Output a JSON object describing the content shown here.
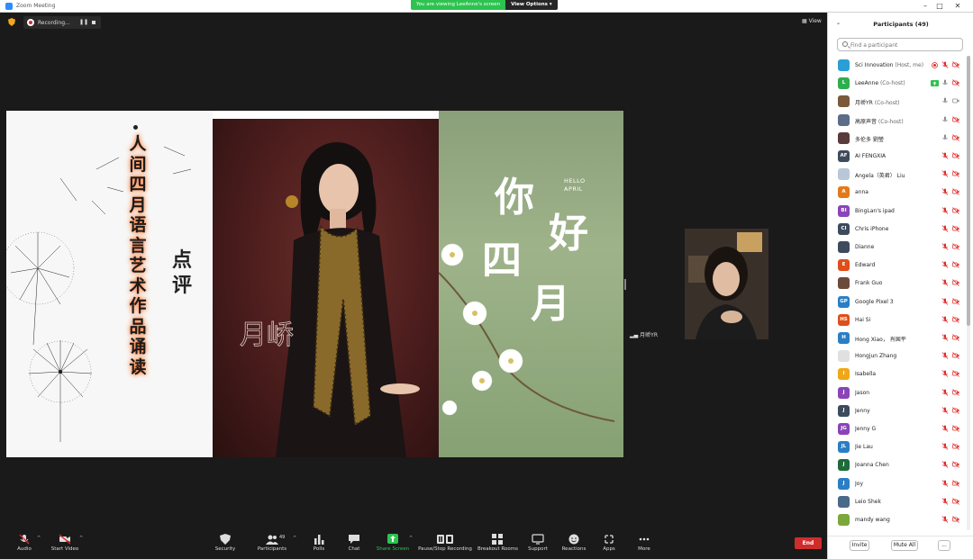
{
  "window": {
    "title": "Zoom Meeting"
  },
  "banner": {
    "viewing": "You are viewing LeeAnne's screen",
    "view_options": "View Options ▾"
  },
  "meeting": {
    "recording_label": "Recording...",
    "view_label": "View",
    "tile_name": "月峤YR"
  },
  "slide": {
    "vertical_title": [
      "人",
      "间",
      "四",
      "月",
      "语",
      "言",
      "艺",
      "术",
      "作",
      "品",
      "诵",
      "读"
    ],
    "review": [
      "点",
      "评"
    ],
    "signature": "月峤",
    "greeting": [
      "你",
      "好",
      "四",
      "月"
    ],
    "hello": [
      "HELLO",
      "APRIL"
    ]
  },
  "toolbar": {
    "audio": "Audio",
    "start_video": "Start Video",
    "security": "Security",
    "participants": "Participants",
    "participants_count": "49",
    "polls": "Polls",
    "chat": "Chat",
    "share_screen": "Share Screen",
    "pause_recording": "Pause/Stop Recording",
    "breakout_rooms": "Breakout Rooms",
    "support": "Support",
    "reactions": "Reactions",
    "apps": "Apps",
    "more": "More",
    "end": "End"
  },
  "panel": {
    "title": "Participants (49)",
    "search_placeholder": "Find a participant",
    "invite": "Invite",
    "mute_all": "Mute All",
    "more": "...",
    "participants": [
      {
        "name": "Sci Innovation",
        "role": " (Host, me)",
        "initials": "",
        "color": "#2a9fd6",
        "mic": "rec",
        "cam": "off"
      },
      {
        "name": "LeeAnne",
        "role": " (Co-host)",
        "initials": "L",
        "color": "#2eae4f",
        "mic": "on",
        "cam": "off",
        "sharing": true
      },
      {
        "name": "月峤YR",
        "role": " (Co-host)",
        "initials": "",
        "color": "#7a5a3a",
        "mic": "on",
        "cam": "on"
      },
      {
        "name": "高原声音",
        "role": " (Co-host)",
        "initials": "",
        "color": "#5b6d88",
        "mic": "on",
        "cam": "off"
      },
      {
        "name": "多伦多 劉瑩",
        "role": "",
        "initials": "",
        "color": "#5a3b3b",
        "mic": "on",
        "cam": "off"
      },
      {
        "name": "AI FENGXIA",
        "role": "",
        "initials": "AF",
        "color": "#3d4b5c",
        "mic": "off",
        "cam": "off"
      },
      {
        "name": "Angela（英君） Liu",
        "role": "",
        "initials": "",
        "color": "#b9c7d8",
        "mic": "off",
        "cam": "off"
      },
      {
        "name": "anna",
        "role": "",
        "initials": "A",
        "color": "#e27a1a",
        "mic": "off",
        "cam": "off"
      },
      {
        "name": "BingLan's ipad",
        "role": "",
        "initials": "BI",
        "color": "#8a44b8",
        "mic": "off",
        "cam": "off"
      },
      {
        "name": "Chris iPhone",
        "role": "",
        "initials": "CI",
        "color": "#3d4b5c",
        "mic": "off",
        "cam": "off"
      },
      {
        "name": "Dianne",
        "role": "",
        "initials": "",
        "color": "#3d4b5c",
        "mic": "off",
        "cam": "off"
      },
      {
        "name": "Edward",
        "role": "",
        "initials": "E",
        "color": "#e04e1a",
        "mic": "off",
        "cam": "off"
      },
      {
        "name": "Frank Guo",
        "role": "",
        "initials": "",
        "color": "#6b4a3a",
        "mic": "off",
        "cam": "off"
      },
      {
        "name": "Google Pixel 3",
        "role": "",
        "initials": "GP",
        "color": "#2a7fc4",
        "mic": "off",
        "cam": "off"
      },
      {
        "name": "Hai Si",
        "role": "",
        "initials": "HS",
        "color": "#e04e1a",
        "mic": "off",
        "cam": "off"
      },
      {
        "name": "Hong Xiao， 肖国平",
        "role": "",
        "initials": "H",
        "color": "#2a7fc4",
        "mic": "off",
        "cam": "off"
      },
      {
        "name": "Hongjun Zhang",
        "role": "",
        "initials": "",
        "color": "#e0e0e0",
        "mic": "off",
        "cam": "off"
      },
      {
        "name": "Isabella",
        "role": "",
        "initials": "I",
        "color": "#f0a818",
        "mic": "off",
        "cam": "off"
      },
      {
        "name": "Jason",
        "role": "",
        "initials": "J",
        "color": "#8a44b8",
        "mic": "off",
        "cam": "off"
      },
      {
        "name": "Jenny",
        "role": "",
        "initials": "J",
        "color": "#3d4b5c",
        "mic": "off",
        "cam": "off"
      },
      {
        "name": "Jenny G",
        "role": "",
        "initials": "JG",
        "color": "#8a44b8",
        "mic": "off",
        "cam": "off"
      },
      {
        "name": "Jie Lau",
        "role": "",
        "initials": "JL",
        "color": "#2a7fc4",
        "mic": "off",
        "cam": "off"
      },
      {
        "name": "Joanna Chen",
        "role": "",
        "initials": "J",
        "color": "#1e6b3a",
        "mic": "off",
        "cam": "off"
      },
      {
        "name": "Joy",
        "role": "",
        "initials": "J",
        "color": "#2a7fc4",
        "mic": "off",
        "cam": "off"
      },
      {
        "name": "Leio Shek",
        "role": "",
        "initials": "",
        "color": "#4a6a8a",
        "mic": "off",
        "cam": "off"
      },
      {
        "name": "mandy wang",
        "role": "",
        "initials": "",
        "color": "#7aa83a",
        "mic": "off",
        "cam": "off"
      }
    ]
  }
}
